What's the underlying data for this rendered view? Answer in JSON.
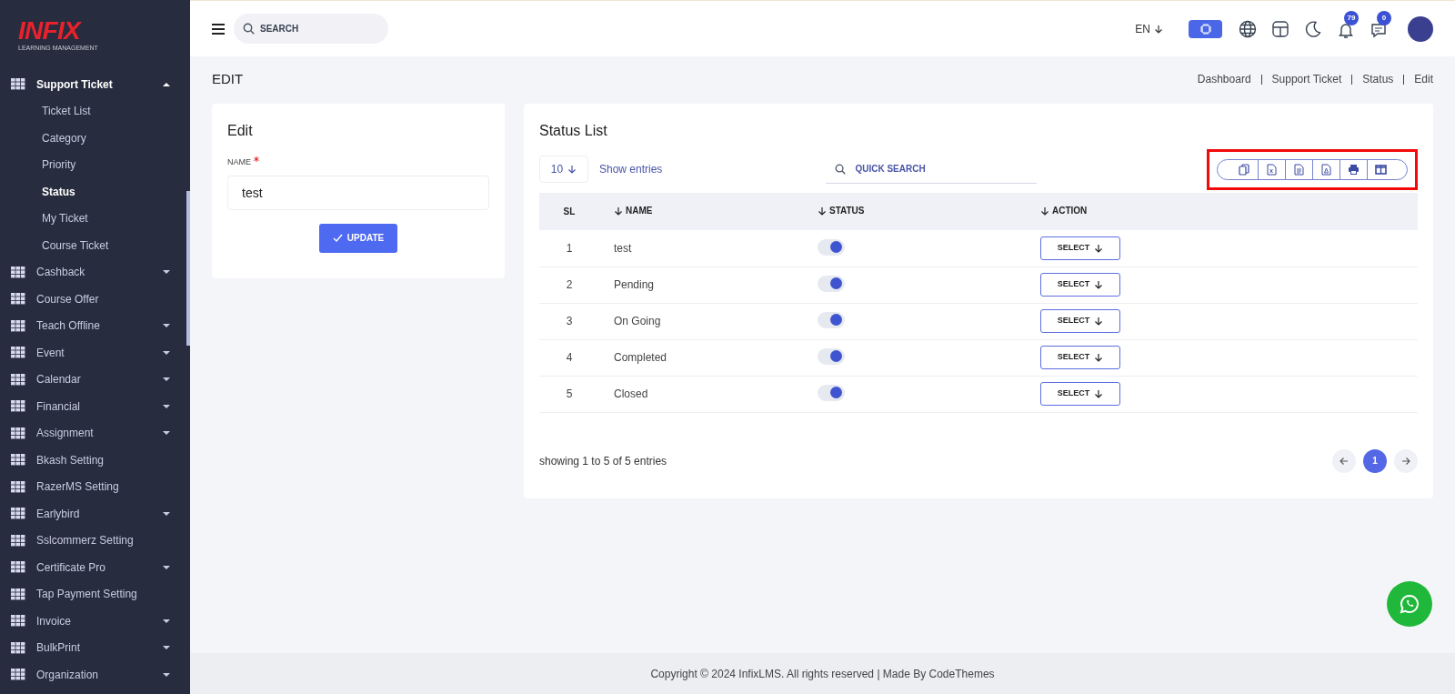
{
  "logo": {
    "title": "INFIX",
    "subtitle": "LEARNING MANAGEMENT"
  },
  "sidebar": {
    "items": [
      {
        "label": "Support Ticket",
        "kind": "menu",
        "expanded": true,
        "children": [
          {
            "label": "Ticket List",
            "selected": false
          },
          {
            "label": "Category",
            "selected": false
          },
          {
            "label": "Priority",
            "selected": false
          },
          {
            "label": "Status",
            "selected": true
          },
          {
            "label": "My Ticket",
            "selected": false
          },
          {
            "label": "Course Ticket",
            "selected": false
          }
        ]
      },
      {
        "label": "Cashback",
        "kind": "menu",
        "expanded": false
      },
      {
        "label": "Course Offer",
        "kind": "link"
      },
      {
        "label": "Teach Offline",
        "kind": "menu",
        "expanded": false
      },
      {
        "label": "Event",
        "kind": "menu",
        "expanded": false
      },
      {
        "label": "Calendar",
        "kind": "menu",
        "expanded": false
      },
      {
        "label": "Financial",
        "kind": "menu",
        "expanded": false
      },
      {
        "label": "Assignment",
        "kind": "menu",
        "expanded": false
      },
      {
        "label": "Bkash Setting",
        "kind": "link"
      },
      {
        "label": "RazerMS Setting",
        "kind": "link"
      },
      {
        "label": "Earlybird",
        "kind": "menu",
        "expanded": false
      },
      {
        "label": "Sslcommerz Setting",
        "kind": "link"
      },
      {
        "label": "Certificate Pro",
        "kind": "menu",
        "expanded": false
      },
      {
        "label": "Tap Payment Setting",
        "kind": "link"
      },
      {
        "label": "Invoice",
        "kind": "menu",
        "expanded": false
      },
      {
        "label": "BulkPrint",
        "kind": "menu",
        "expanded": false
      },
      {
        "label": "Organization",
        "kind": "menu",
        "expanded": false
      }
    ]
  },
  "header": {
    "search_placeholder": "SEARCH",
    "language": "EN",
    "notification_count": "79",
    "message_count": "0"
  },
  "page_title": "EDIT",
  "breadcrumb": [
    "Dashboard",
    "Support Ticket",
    "Status",
    "Edit"
  ],
  "edit_form": {
    "title": "Edit",
    "field_label": "NAME",
    "required": true,
    "value": "test",
    "button": "UPDATE"
  },
  "status_list": {
    "title": "Status List",
    "page_size": "10",
    "show_entries": "Show entries",
    "search_placeholder": "QUICK SEARCH",
    "export_buttons": [
      {
        "kind": "copy"
      },
      {
        "kind": "excel"
      },
      {
        "kind": "csv"
      },
      {
        "kind": "pdf"
      },
      {
        "kind": "print"
      },
      {
        "kind": "columns"
      }
    ],
    "export_highlighted": true,
    "columns": [
      {
        "label": "SL",
        "sortable": false
      },
      {
        "label": "NAME",
        "sortable": true
      },
      {
        "label": "STATUS",
        "sortable": true
      },
      {
        "label": "ACTION",
        "sortable": true
      }
    ],
    "rows": [
      {
        "sl": "1",
        "name": "test",
        "on": true,
        "action": "SELECT"
      },
      {
        "sl": "2",
        "name": "Pending",
        "on": true,
        "action": "SELECT"
      },
      {
        "sl": "3",
        "name": "On Going",
        "on": true,
        "action": "SELECT"
      },
      {
        "sl": "4",
        "name": "Completed",
        "on": true,
        "action": "SELECT"
      },
      {
        "sl": "5",
        "name": "Closed",
        "on": true,
        "action": "SELECT"
      }
    ],
    "summary": "showing 1 to 5 of 5 entries",
    "pages": [
      {
        "label": "1",
        "selected": true
      }
    ]
  },
  "footer": "Copyright © 2024 InfixLMS. All rights reserved | Made By CodeThemes"
}
